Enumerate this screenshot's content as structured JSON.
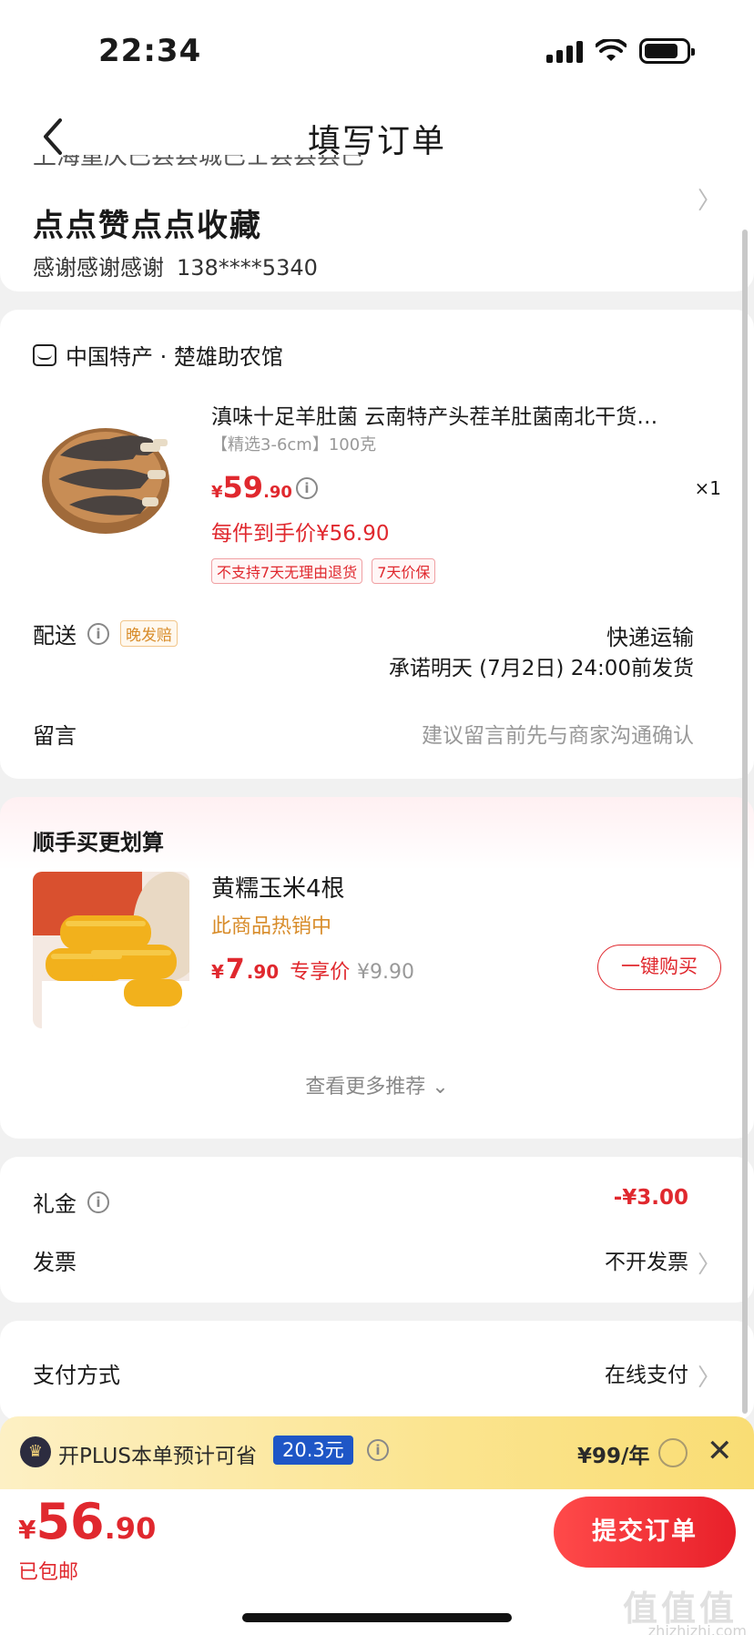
{
  "status_bar": {
    "time": "22:34"
  },
  "nav": {
    "back_icon": "chevron-left-icon",
    "title": "填写订单"
  },
  "address": {
    "partial_line": "上海重庆巴县县城巴士县县县巴",
    "name": "点点赞点点收藏",
    "contact_name": "感谢感谢感谢",
    "phone": "138****5340"
  },
  "order": {
    "shop_name": "中国特产 · 楚雄助农馆",
    "product": {
      "title": "滇味十足羊肚菌 云南特产头茬羊肚菌南北干货…",
      "spec": "【精选3-6cm】100克",
      "price_yen": "¥",
      "price_int": "59",
      "price_dec": ".90",
      "quantity": "×1",
      "hand_price": "每件到手价¥56.90",
      "tags": [
        "不支持7天无理由退货",
        "7天价保"
      ]
    },
    "shipping": {
      "label": "配送",
      "late_tag": "晚发赔",
      "method": "快递运输",
      "promise": "承诺明天 (7月2日) 24:00前发货"
    },
    "note": {
      "label": "留言",
      "placeholder": "建议留言前先与商家沟通确认"
    }
  },
  "recommend": {
    "title": "顺手买更划算",
    "item": {
      "name": "黄糯玉米4根",
      "hot": "此商品热销中",
      "price_yen": "¥",
      "price_int": "7",
      "price_dec": ".90",
      "exclusive": "专享价",
      "orig_price": "¥9.90",
      "buy_label": "一键购买"
    },
    "more_label": "查看更多推荐 ⌄"
  },
  "discounts": {
    "gift_label": "礼金",
    "gift_value": "-¥3.00",
    "invoice_label": "发票",
    "invoice_value": "不开发票"
  },
  "payment": {
    "label": "支付方式",
    "value": "在线支付"
  },
  "plus_banner": {
    "logo": "♛",
    "text": "开PLUS本单预计可省",
    "save": "20.3元",
    "price": "¥99/年",
    "close_icon": "close-icon"
  },
  "bottom": {
    "total_yen": "¥",
    "total_int": "56",
    "total_dec": ".90",
    "free_shipping": "已包邮",
    "submit_label": "提交订单",
    "watermark": "值值值",
    "watermark_url": "zhizhizhi.com"
  },
  "colors": {
    "accent": "#e0282e",
    "hot": "#d88c2a",
    "plus_blue": "#1e56c6"
  }
}
